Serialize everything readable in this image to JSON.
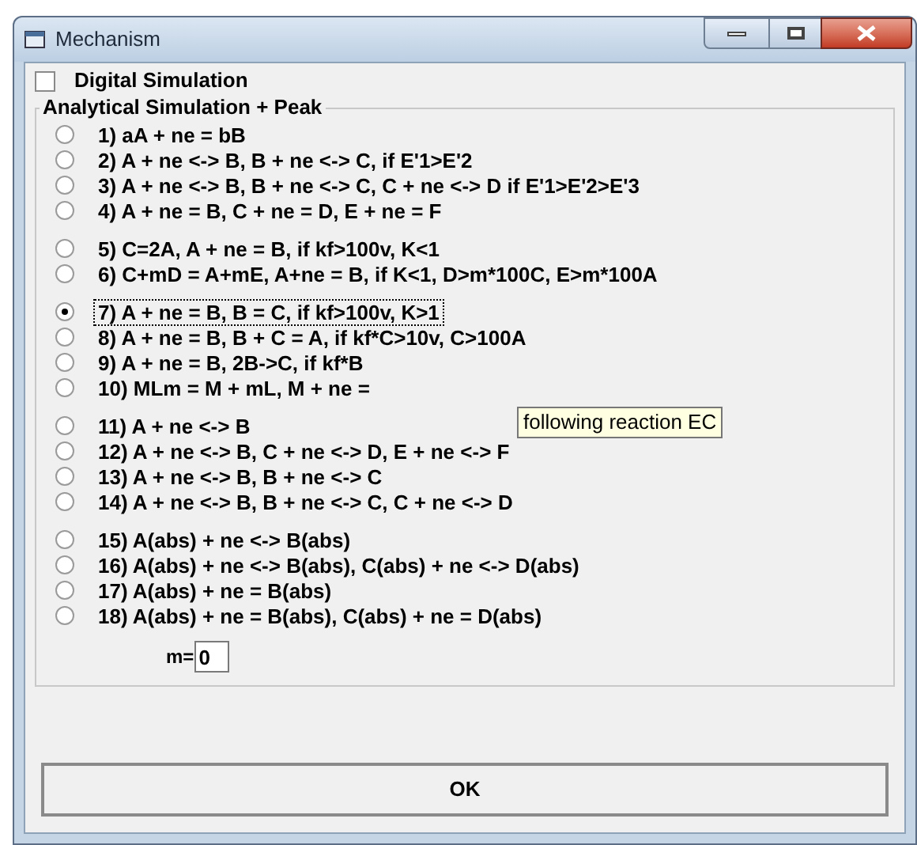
{
  "window": {
    "title": "Mechanism"
  },
  "digital_simulation": {
    "label": "Digital Simulation",
    "checked": false
  },
  "analytical_group": {
    "title": "Analytical Simulation + Peak",
    "groups": [
      {
        "options": [
          {
            "label": "1)  aA + ne = bB",
            "selected": false,
            "focused": false
          },
          {
            "label": "2)  A + ne <-> B, B + ne <-> C, if E'1>E'2",
            "selected": false,
            "focused": false
          },
          {
            "label": "3)  A + ne <-> B, B + ne <-> C, C + ne <-> D if E'1>E'2>E'3",
            "selected": false,
            "focused": false
          },
          {
            "label": "4)  A + ne = B, C + ne = D, E + ne = F",
            "selected": false,
            "focused": false
          }
        ]
      },
      {
        "options": [
          {
            "label": "5)  C=2A, A + ne = B, if kf>100v, K<1",
            "selected": false,
            "focused": false
          },
          {
            "label": "6)  C+mD = A+mE, A+ne = B, if K<1, D>m*100C, E>m*100A",
            "selected": false,
            "focused": false
          }
        ]
      },
      {
        "options": [
          {
            "label": "7)  A + ne = B, B = C, if kf>100v, K>1",
            "selected": true,
            "focused": true
          },
          {
            "label": "8)  A + ne = B, B + C = A, if kf*C>10v, C>100A",
            "selected": false,
            "focused": false
          },
          {
            "label": "9)  A + ne = B, 2B->C, if kf*B",
            "selected": false,
            "focused": false
          },
          {
            "label": "10)  MLm = M + mL, M + ne =",
            "selected": false,
            "focused": false
          }
        ]
      },
      {
        "options": [
          {
            "label": "11)  A + ne <-> B",
            "selected": false,
            "focused": false
          },
          {
            "label": "12)  A + ne <-> B, C + ne <-> D, E + ne <-> F",
            "selected": false,
            "focused": false
          },
          {
            "label": "13)  A + ne <-> B, B + ne <-> C",
            "selected": false,
            "focused": false
          },
          {
            "label": "14)  A + ne <-> B, B + ne <-> C, C + ne <-> D",
            "selected": false,
            "focused": false
          }
        ]
      },
      {
        "options": [
          {
            "label": "15)  A(abs) + ne <-> B(abs)",
            "selected": false,
            "focused": false
          },
          {
            "label": "16)  A(abs) + ne <-> B(abs), C(abs) + ne <-> D(abs)",
            "selected": false,
            "focused": false
          },
          {
            "label": "17)  A(abs) + ne = B(abs)",
            "selected": false,
            "focused": false
          },
          {
            "label": "18)  A(abs) + ne = B(abs),  C(abs) + ne = D(abs)",
            "selected": false,
            "focused": false
          }
        ]
      }
    ],
    "m_field": {
      "label": "m=",
      "value": "0"
    }
  },
  "tooltip": {
    "text": "following  reaction EC"
  },
  "buttons": [
    {
      "label": "OK"
    }
  ]
}
